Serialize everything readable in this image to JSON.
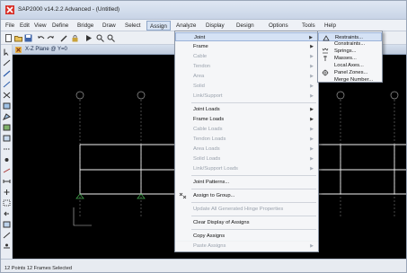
{
  "app": {
    "title": "SAP2000 v14.2.2 Advanced  - (Untitled)"
  },
  "menubar": {
    "items": [
      "File",
      "Edit",
      "View",
      "Define",
      "Bridge",
      "Draw",
      "Select",
      "Assign",
      "Analyze",
      "Display",
      "Design",
      "Options",
      "Tools",
      "Help"
    ]
  },
  "view": {
    "title": "X-Z Plane @ Y=0",
    "grid_labels": [
      "A",
      "B",
      "C",
      "D",
      "E"
    ]
  },
  "status": {
    "text": "12 Points  12 Frames Selected"
  },
  "assign_menu": {
    "items": [
      {
        "label": "Joint",
        "submenu": true,
        "disabled": false,
        "highlight": true
      },
      {
        "label": "Frame",
        "submenu": true,
        "disabled": false
      },
      {
        "label": "Cable",
        "submenu": true,
        "disabled": true
      },
      {
        "label": "Tendon",
        "submenu": true,
        "disabled": true
      },
      {
        "label": "Area",
        "submenu": true,
        "disabled": true
      },
      {
        "label": "Solid",
        "submenu": true,
        "disabled": true
      },
      {
        "label": "Link/Support",
        "submenu": true,
        "disabled": true
      },
      {
        "label": "Joint Loads",
        "submenu": true,
        "disabled": false
      },
      {
        "label": "Frame Loads",
        "submenu": true,
        "disabled": false
      },
      {
        "label": "Cable Loads",
        "submenu": true,
        "disabled": true
      },
      {
        "label": "Tendon Loads",
        "submenu": true,
        "disabled": true
      },
      {
        "label": "Area Loads",
        "submenu": true,
        "disabled": true
      },
      {
        "label": "Solid Loads",
        "submenu": true,
        "disabled": true
      },
      {
        "label": "Link/Support Loads",
        "submenu": true,
        "disabled": true
      },
      {
        "label": "Joint Patterns...",
        "submenu": false,
        "disabled": false
      },
      {
        "label": "Assign to Group...",
        "submenu": false,
        "disabled": false,
        "icon": "group-icon"
      },
      {
        "label": "Update All Generated Hinge Properties",
        "submenu": false,
        "disabled": true
      },
      {
        "label": "Clear Display of Assigns",
        "submenu": false,
        "disabled": false
      },
      {
        "label": "Copy Assigns",
        "submenu": false,
        "disabled": false
      },
      {
        "label": "Paste Assigns",
        "submenu": true,
        "disabled": true
      }
    ]
  },
  "joint_submenu": {
    "items": [
      {
        "label": "Restraints...",
        "icon": "restraint-icon",
        "highlight": true
      },
      {
        "label": "Constraints...",
        "icon": ""
      },
      {
        "label": "Springs...",
        "icon": "spring-icon"
      },
      {
        "label": "Masses...",
        "icon": "mass-icon"
      },
      {
        "label": "Local Axes...",
        "icon": ""
      },
      {
        "label": "Panel Zones...",
        "icon": "panel-zone-icon"
      },
      {
        "label": "Merge Number...",
        "icon": ""
      }
    ]
  },
  "colors": {
    "accent": "#2b5cab",
    "canvas_bg": "#000000",
    "grid": "#8a8a8a",
    "frame": "#ffffff"
  }
}
